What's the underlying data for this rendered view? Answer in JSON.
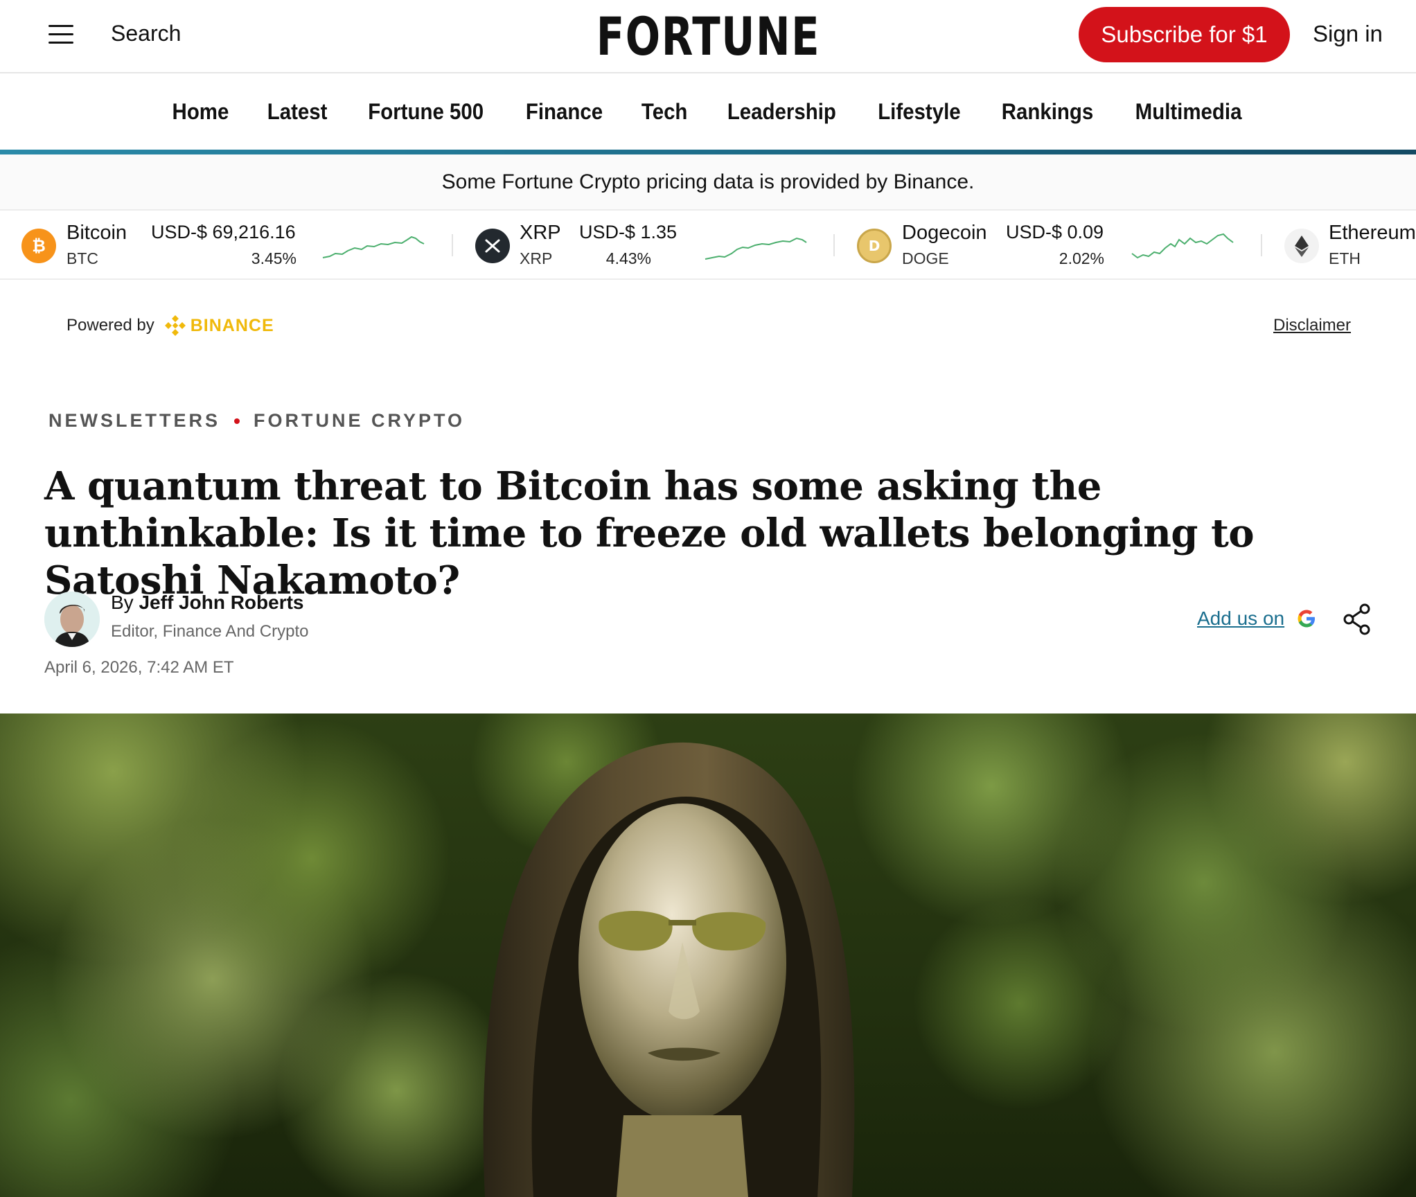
{
  "header": {
    "search_label": "Search",
    "logo_text": "FORTUNE",
    "subscribe_label": "Subscribe for $1",
    "signin_label": "Sign in"
  },
  "nav": {
    "items": [
      "Home",
      "Latest",
      "Fortune 500",
      "Finance",
      "Tech",
      "Leadership",
      "Lifestyle",
      "Rankings",
      "Multimedia"
    ]
  },
  "crypto_notice": "Some Fortune Crypto pricing data is provided by Binance.",
  "ticker": [
    {
      "name": "Bitcoin",
      "symbol": "BTC",
      "price": "USD-$ 69,216.16",
      "change": "3.45%",
      "icon": "bitcoin-icon"
    },
    {
      "name": "XRP",
      "symbol": "XRP",
      "price": "USD-$ 1.35",
      "change": "4.43%",
      "icon": "xrp-icon"
    },
    {
      "name": "Dogecoin",
      "symbol": "DOGE",
      "price": "USD-$ 0.09",
      "change": "2.02%",
      "icon": "dogecoin-icon"
    },
    {
      "name": "Ethereum",
      "symbol": "ETH",
      "icon": "ethereum-icon"
    }
  ],
  "powered_by": {
    "label": "Powered by",
    "brand": "BINANCE",
    "disclaimer": "Disclaimer"
  },
  "article": {
    "kicker": [
      "NEWSLETTERS",
      "FORTUNE CRYPTO"
    ],
    "headline": "A quantum threat to Bitcoin has some asking the unthinkable: Is it time to freeze old wallets belonging to Satoshi Nakamoto?",
    "by_prefix": "By",
    "author": "Jeff John Roberts",
    "author_role": "Editor, Finance And Crypto",
    "date": "April 6, 2026, 7:42 AM ET",
    "add_us_label": "Add us on"
  },
  "colors": {
    "brand_red": "#d3121a",
    "link_teal": "#1a6e8e",
    "binance_yellow": "#f0b90b",
    "sparkline_green": "#4caf6e"
  }
}
